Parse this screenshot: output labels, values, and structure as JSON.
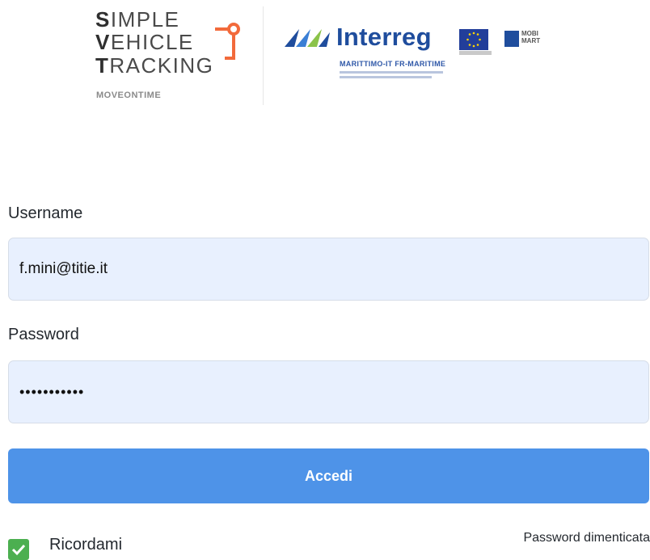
{
  "header": {
    "logo_line1_initial": "S",
    "logo_line1_rest": "IMPLE",
    "logo_line2_initial": "V",
    "logo_line2_rest": "EHICLE",
    "logo_line3_initial": "T",
    "logo_line3_rest": "RACKING",
    "logo_subtitle": "MOVEONTIME",
    "partner_name": "Interreg",
    "partner_subtitle": "MARITTIMO-IT FR-MARITIME",
    "partner_logo_text": "MOBI MART",
    "brand_color": "#1f4d9d",
    "accent_color": "#f26a3b"
  },
  "form": {
    "username_label": "Username",
    "username_value": "f.mini@titie.it",
    "password_label": "Password",
    "password_value": "•••••••••••",
    "submit_label": "Accedi",
    "remember_label": "Ricordami",
    "remember_checked": true,
    "forgot_label": "Password dimenticata"
  },
  "colors": {
    "input_bg": "#e8f0fe",
    "button_bg": "#4e93e8",
    "checkbox_bg": "#4caf50"
  }
}
